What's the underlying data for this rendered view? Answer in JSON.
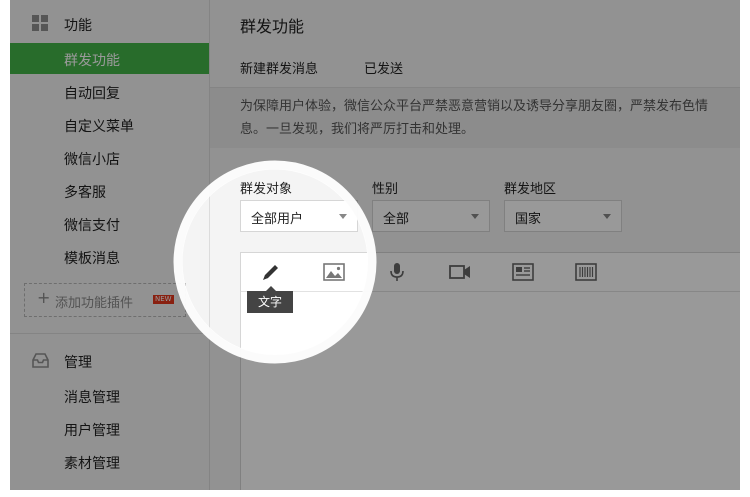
{
  "sidebar": {
    "features_label": "功能",
    "items": [
      {
        "label": "群发功能"
      },
      {
        "label": "自动回复"
      },
      {
        "label": "自定义菜单"
      },
      {
        "label": "微信小店"
      },
      {
        "label": "多客服"
      },
      {
        "label": "微信支付"
      },
      {
        "label": "模板消息"
      }
    ],
    "plugin_label": "添加功能插件",
    "plugin_badge": "NEW",
    "manage_label": "管理",
    "manage_items": [
      {
        "label": "消息管理"
      },
      {
        "label": "用户管理"
      },
      {
        "label": "素材管理"
      }
    ]
  },
  "main": {
    "title": "群发功能",
    "tabs": [
      {
        "label": "新建群发消息"
      },
      {
        "label": "已发送"
      }
    ],
    "notice_line1": "为保障用户体验，微信公众平台严禁恶意营销以及诱导分享朋友圈，严禁发布色情",
    "notice_line2": "息。一旦发现，我们将严厉打击和处理。",
    "filters": {
      "target_label": "群发对象",
      "target_value": "全部用户",
      "gender_label": "性别",
      "gender_value": "全部",
      "region_label": "群发地区",
      "region_value": "国家"
    },
    "editor": {
      "tooltip": "文字",
      "tools": [
        "pencil-icon",
        "image-icon",
        "microphone-icon",
        "video-icon",
        "article-icon",
        "barcode-icon"
      ]
    }
  },
  "colors": {
    "accent": "#44b549",
    "overlay": "rgba(0,0,0,0.40)"
  }
}
